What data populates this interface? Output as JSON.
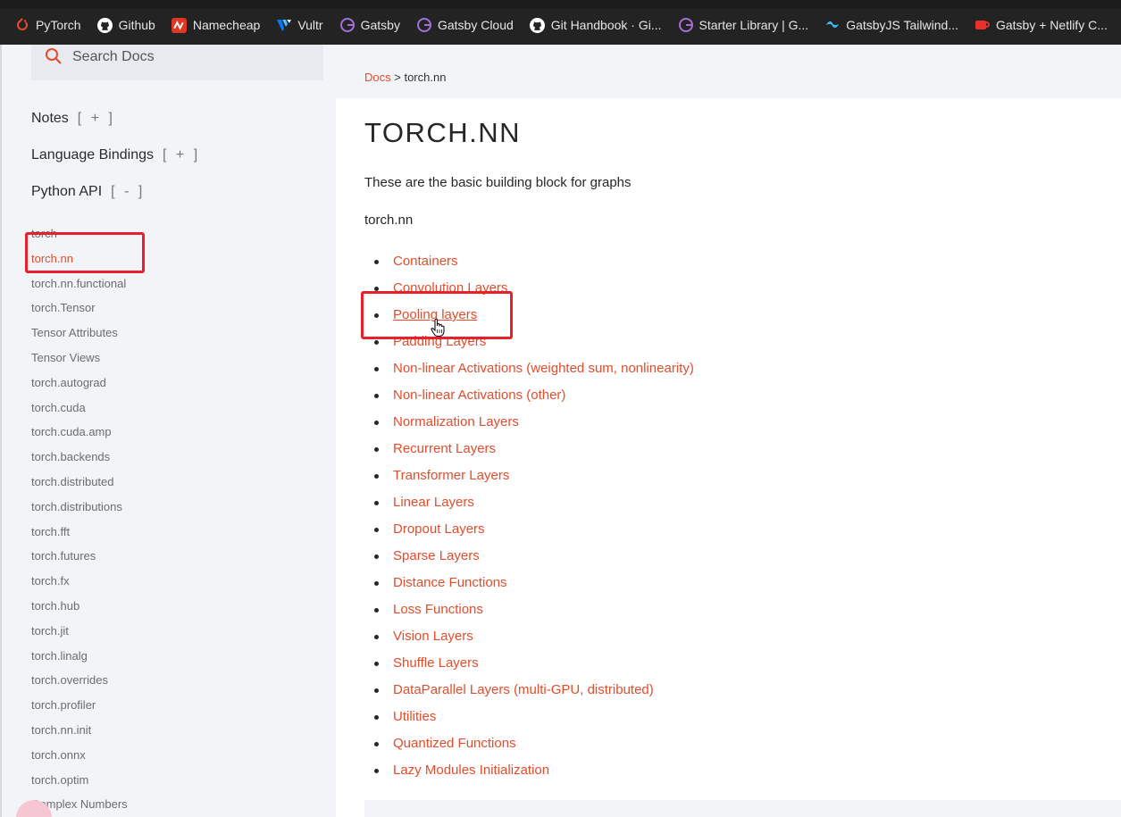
{
  "bookmarks_bar": {
    "items": [
      {
        "label": "PyTorch",
        "icon": "pytorch-icon",
        "color": "#ee4c2c"
      },
      {
        "label": "Github",
        "icon": "github-icon",
        "color": "#ffffff"
      },
      {
        "label": "Namecheap",
        "icon": "namecheap-icon",
        "color": "#de3723"
      },
      {
        "label": "Vultr",
        "icon": "vultr-icon",
        "color": "#007bfc"
      },
      {
        "label": "Gatsby",
        "icon": "gatsby-icon",
        "color": "#8a4baf"
      },
      {
        "label": "Gatsby Cloud",
        "icon": "gatsby-icon",
        "color": "#8a4baf"
      },
      {
        "label": "Git Handbook · Gi...",
        "icon": "github-icon",
        "color": "#ffffff"
      },
      {
        "label": "Starter Library | G...",
        "icon": "gatsby-icon",
        "color": "#8a4baf"
      },
      {
        "label": "GatsbyJS Tailwind...",
        "icon": "tailwind-icon",
        "color": "#38bdf8"
      },
      {
        "label": "Gatsby + Netlify C...",
        "icon": "coffee-icon",
        "color": "#e8312a"
      }
    ]
  },
  "sidebar": {
    "search_placeholder": "Search Docs",
    "sections": [
      {
        "label": "Notes",
        "toggle": "[ + ]"
      },
      {
        "label": "Language Bindings",
        "toggle": "[ + ]"
      },
      {
        "label": "Python API",
        "toggle": "[ - ]"
      }
    ],
    "api_items": [
      "torch",
      "torch.nn",
      "torch.nn.functional",
      "torch.Tensor",
      "Tensor Attributes",
      "Tensor Views",
      "torch.autograd",
      "torch.cuda",
      "torch.cuda.amp",
      "torch.backends",
      "torch.distributed",
      "torch.distributions",
      "torch.fft",
      "torch.futures",
      "torch.fx",
      "torch.hub",
      "torch.jit",
      "torch.linalg",
      "torch.overrides",
      "torch.profiler",
      "torch.nn.init",
      "torch.onnx",
      "torch.optim",
      "Complex Numbers"
    ],
    "active_item": "torch.nn"
  },
  "main": {
    "breadcrumb": {
      "link": "Docs",
      "separator": ">",
      "current": "torch.nn"
    },
    "title": "TORCH.NN",
    "intro": "These are the basic building block for graphs",
    "module_label": "torch.nn",
    "links": [
      "Containers",
      "Convolution Layers",
      "Pooling layers",
      "Padding Layers",
      "Non-linear Activations (weighted sum, nonlinearity)",
      "Non-linear Activations (other)",
      "Normalization Layers",
      "Recurrent Layers",
      "Transformer Layers",
      "Linear Layers",
      "Dropout Layers",
      "Sparse Layers",
      "Distance Functions",
      "Loss Functions",
      "Vision Layers",
      "Shuffle Layers",
      "DataParallel Layers (multi-GPU, distributed)",
      "Utilities",
      "Quantized Functions",
      "Lazy Modules Initialization"
    ],
    "hovered_link": "Pooling layers"
  },
  "colors": {
    "accent": "#e44c2c",
    "highlight_box": "#e8202a"
  }
}
